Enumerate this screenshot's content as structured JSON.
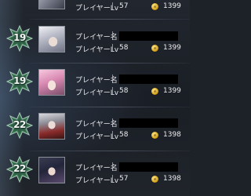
{
  "rows": [
    {
      "rank": "",
      "name_label": "",
      "lv_label": "プレイヤーLv",
      "lv": "57",
      "score": "1399",
      "avatar": "white-hair-character"
    },
    {
      "rank": "19",
      "name_label": "プレイヤー名",
      "lv_label": "プレイヤーLv",
      "lv": "58",
      "score": "1399",
      "avatar": "silver-hair-character"
    },
    {
      "rank": "19",
      "name_label": "プレイヤー名",
      "lv_label": "プレイヤーLv",
      "lv": "58",
      "score": "1399",
      "avatar": "pink-hair-character"
    },
    {
      "rank": "22",
      "name_label": "プレイヤー名",
      "lv_label": "プレイヤーLv",
      "lv": "58",
      "score": "1398",
      "avatar": "red-cape-character"
    },
    {
      "rank": "22",
      "name_label": "プレイヤー名",
      "lv_label": "プレイヤーLv",
      "lv": "57",
      "score": "1398",
      "avatar": "dark-hair-character"
    }
  ],
  "separator": "|",
  "colors": {
    "rank_badge": "#3f7a58",
    "rank_badge_edge": "#a6c9b5",
    "name_redaction": "#000000",
    "coin": "#d6a520"
  },
  "icons": {
    "currency": "coin-icon",
    "rank": "star-badge-icon"
  }
}
